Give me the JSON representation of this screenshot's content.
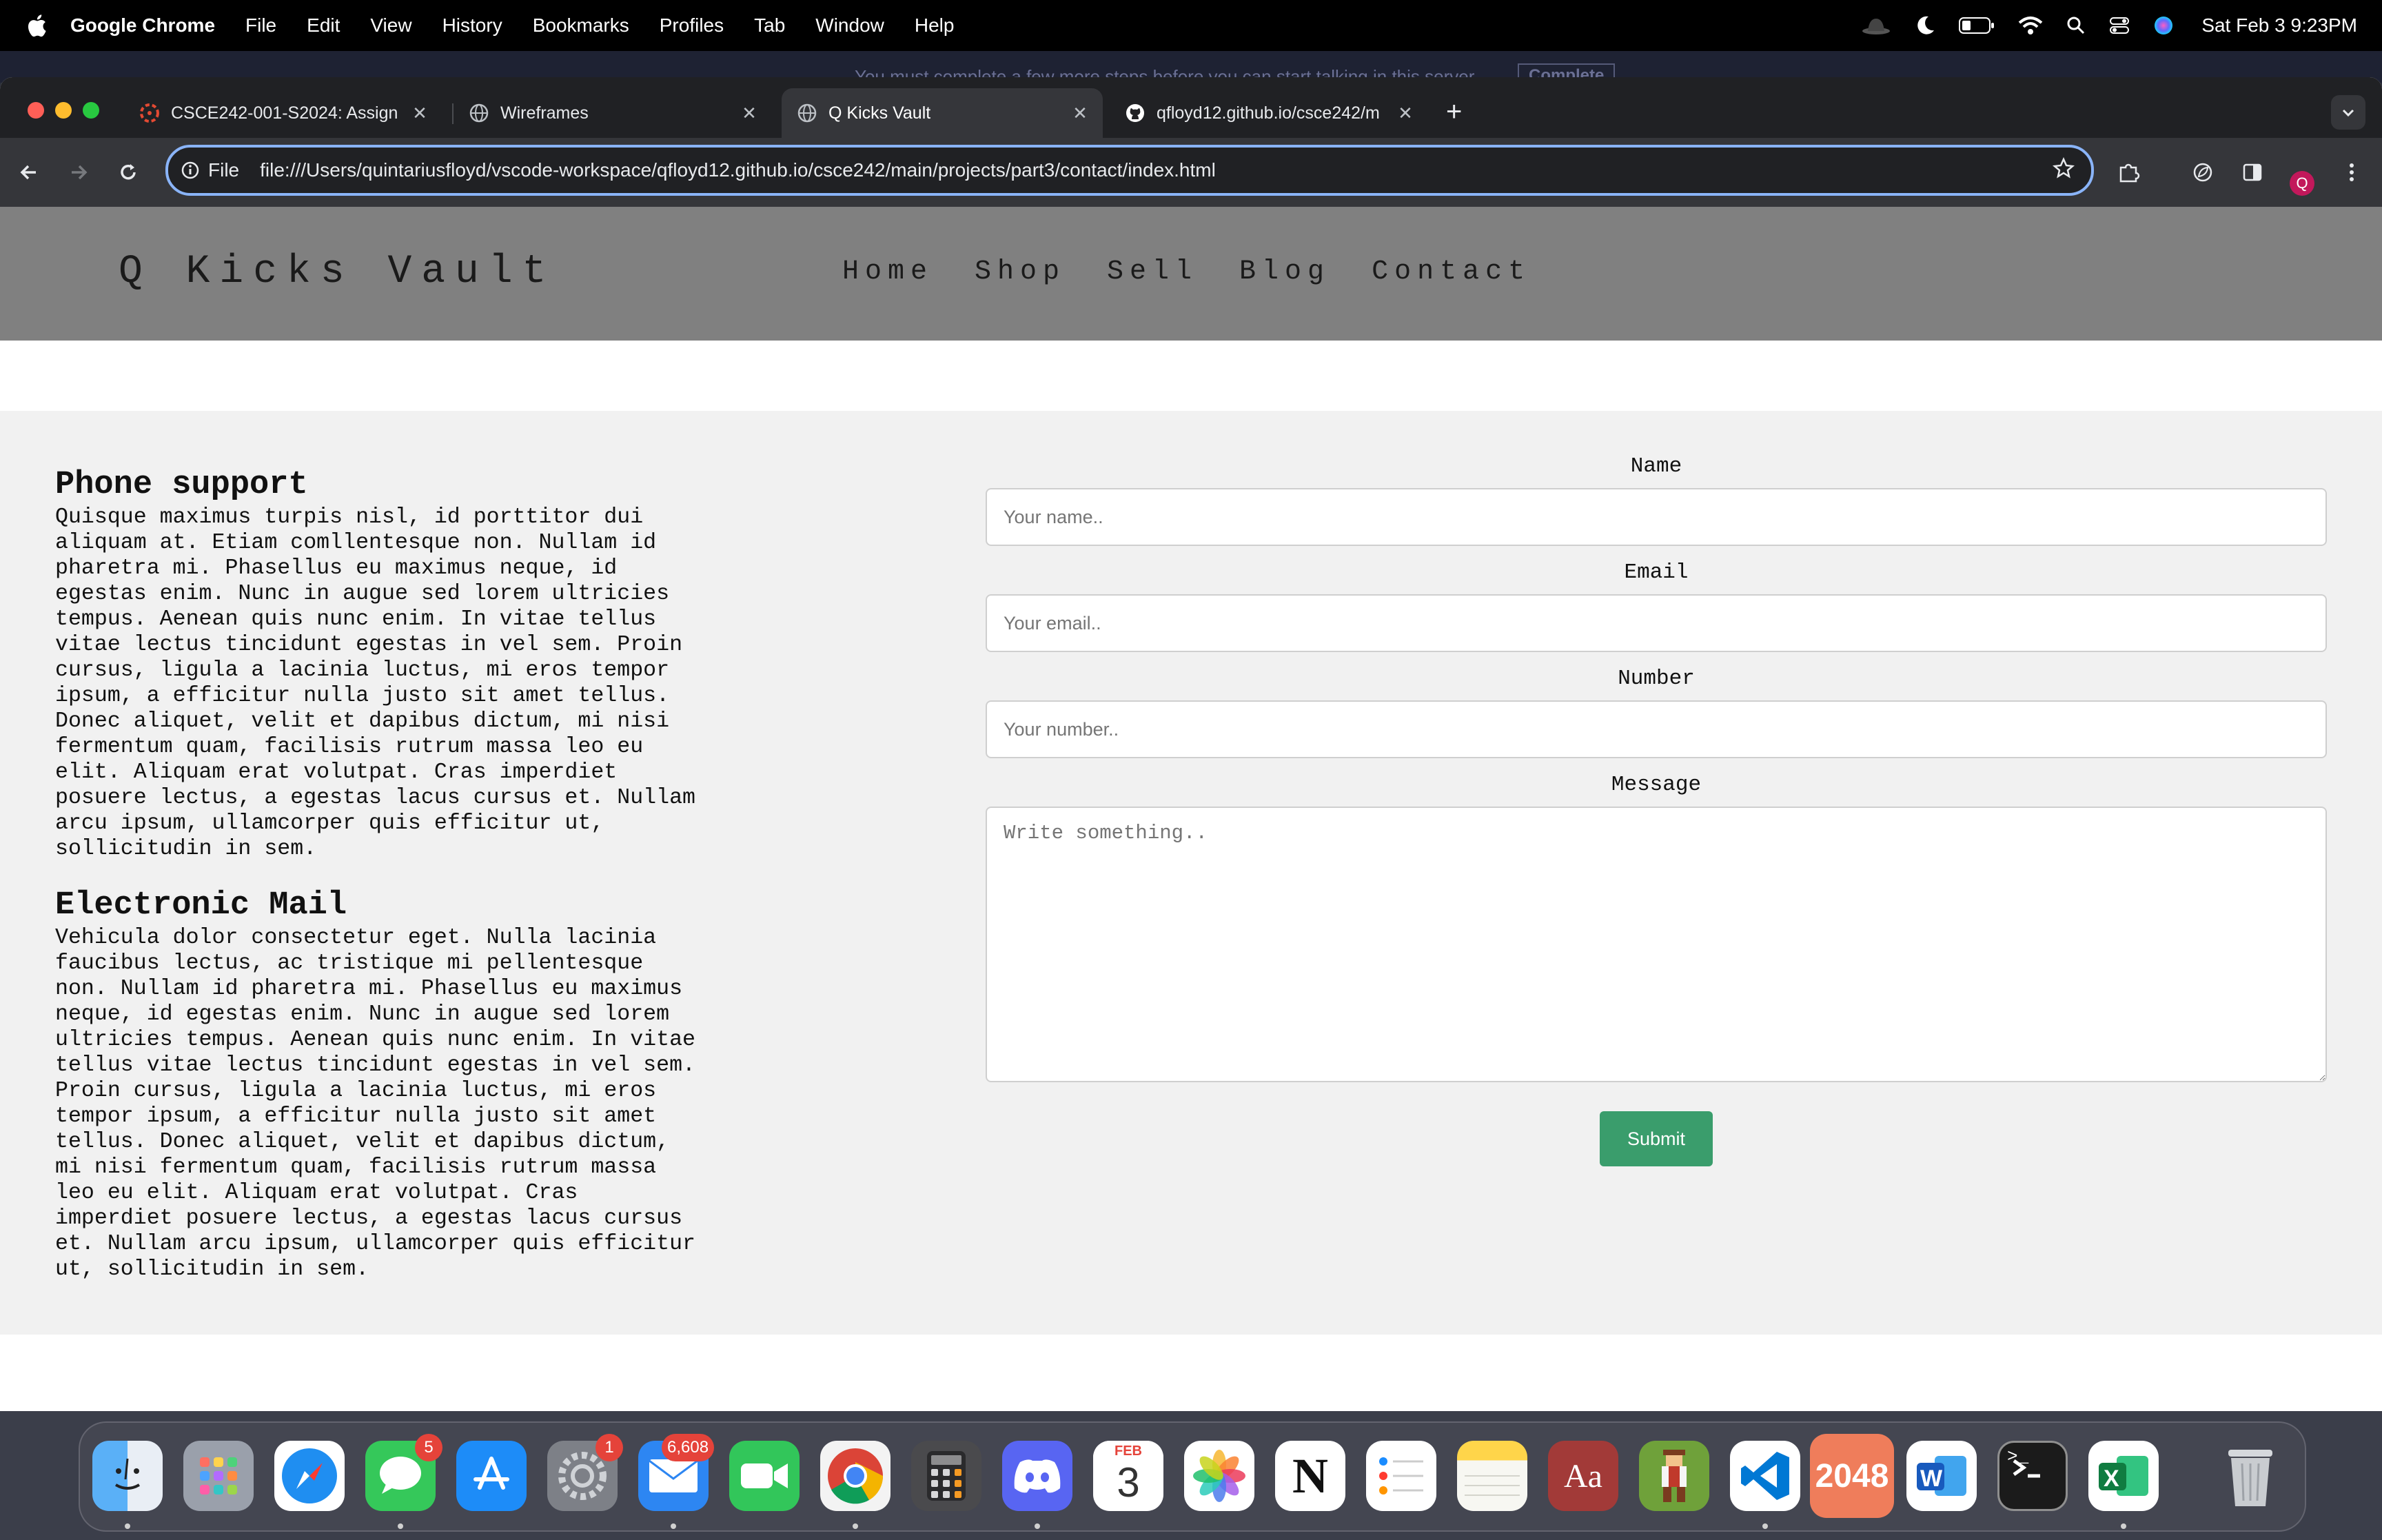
{
  "menubar": {
    "app": "Google Chrome",
    "items": [
      "File",
      "Edit",
      "View",
      "History",
      "Bookmarks",
      "Profiles",
      "Tab",
      "Window",
      "Help"
    ],
    "clock": "Sat Feb 3  9:23PM"
  },
  "behind_window": {
    "banner_text": "You must complete a few more steps before you can start talking in this server.",
    "banner_button": "Complete"
  },
  "browser": {
    "tabs": [
      {
        "title": "CSCE242-001-S2024: Assign",
        "icon": "canvas-favicon-icon",
        "active": false
      },
      {
        "title": "Wireframes",
        "icon": "globe-icon",
        "active": false
      },
      {
        "title": "Q Kicks Vault",
        "icon": "globe-icon",
        "active": true
      },
      {
        "title": "qfloyd12.github.io/csce242/m",
        "icon": "github-icon",
        "active": false
      }
    ],
    "address_chip": "File",
    "url": "file:///Users/quintariusfloyd/vscode-workspace/qfloyd12.github.io/csce242/main/projects/part3/contact/index.html",
    "profile_initial": "Q",
    "accent": "#8ab4f8"
  },
  "site": {
    "title": "Q Kicks Vault",
    "nav": [
      "Home",
      "Shop",
      "Sell",
      "Blog",
      "Contact"
    ],
    "phone": {
      "heading": "Phone support",
      "body": "Quisque maximus turpis nisl, id porttitor dui aliquam at. Etiam comllentesque non. Nullam id pharetra mi. Phasellus eu maximus neque, id egestas enim. Nunc in augue sed lorem ultricies tempus. Aenean quis nunc enim. In vitae tellus vitae lectus tincidunt egestas in vel sem. Proin cursus, ligula a lacinia luctus, mi eros tempor ipsum, a efficitur nulla justo sit amet tellus. Donec aliquet, velit et dapibus dictum, mi nisi fermentum quam, facilisis rutrum massa leo eu elit. Aliquam erat volutpat. Cras imperdiet posuere lectus, a egestas lacus cursus et. Nullam arcu ipsum, ullamcorper quis efficitur ut, sollicitudin in sem."
    },
    "email": {
      "heading": "Electronic Mail",
      "body": "Vehicula dolor consectetur eget. Nulla lacinia faucibus lectus, ac tristique mi pellentesque non. Nullam id pharetra mi. Phasellus eu maximus neque, id egestas enim. Nunc in augue sed lorem ultricies tempus. Aenean quis nunc enim. In vitae tellus vitae lectus tincidunt egestas in vel sem. Proin cursus, ligula a lacinia luctus, mi eros tempor ipsum, a efficitur nulla justo sit amet tellus. Donec aliquet, velit et dapibus dictum, mi nisi fermentum quam, facilisis rutrum massa leo eu elit. Aliquam erat volutpat. Cras imperdiet posuere lectus, a egestas lacus cursus et. Nullam arcu ipsum, ullamcorper quis efficitur ut, sollicitudin in sem."
    },
    "form": {
      "name_label": "Name",
      "name_placeholder": "Your name..",
      "name_value": "",
      "email_label": "Email",
      "email_placeholder": "Your email..",
      "email_value": "",
      "number_label": "Number",
      "number_placeholder": "Your number..",
      "number_value": "",
      "message_label": "Message",
      "message_placeholder": "Write something..",
      "message_value": "",
      "submit": "Submit",
      "submit_color": "#3a9d6c"
    }
  },
  "dock": {
    "apps": [
      {
        "name": "Finder",
        "icon": "finder-icon"
      },
      {
        "name": "Launchpad",
        "icon": "launchpad-icon"
      },
      {
        "name": "Safari",
        "icon": "safari-icon"
      },
      {
        "name": "Messages",
        "icon": "messages-icon",
        "badge": "5"
      },
      {
        "name": "App Store",
        "icon": "app-store-icon"
      },
      {
        "name": "System Settings",
        "icon": "settings-icon",
        "badge": "1"
      },
      {
        "name": "Mail",
        "icon": "mail-icon",
        "badge": "6,608"
      },
      {
        "name": "FaceTime",
        "icon": "facetime-icon"
      },
      {
        "name": "Google Chrome",
        "icon": "chrome-icon"
      },
      {
        "name": "Calculator",
        "icon": "calculator-icon"
      },
      {
        "name": "Discord",
        "icon": "discord-icon"
      },
      {
        "name": "Calendar",
        "icon": "calendar-icon",
        "month": "FEB",
        "day": "3"
      },
      {
        "name": "Photos",
        "icon": "photos-icon"
      },
      {
        "name": "Notion",
        "icon": "notion-icon",
        "label": "N"
      },
      {
        "name": "Reminders",
        "icon": "reminders-icon"
      },
      {
        "name": "Notes",
        "icon": "notes-icon"
      },
      {
        "name": "Dictionary",
        "icon": "dictionary-icon",
        "label": "Aa"
      },
      {
        "name": "Game",
        "icon": "game-icon"
      },
      {
        "name": "Visual Studio Code",
        "icon": "vscode-icon"
      },
      {
        "name": "2048",
        "icon": "2048-icon",
        "label": "2048"
      },
      {
        "name": "Microsoft Word",
        "icon": "word-icon",
        "label": "W"
      },
      {
        "name": "Terminal",
        "icon": "terminal-icon",
        "label": ">_"
      },
      {
        "name": "Microsoft Excel",
        "icon": "excel-icon",
        "label": "X"
      },
      {
        "name": "Trash",
        "icon": "trash-icon"
      }
    ]
  }
}
